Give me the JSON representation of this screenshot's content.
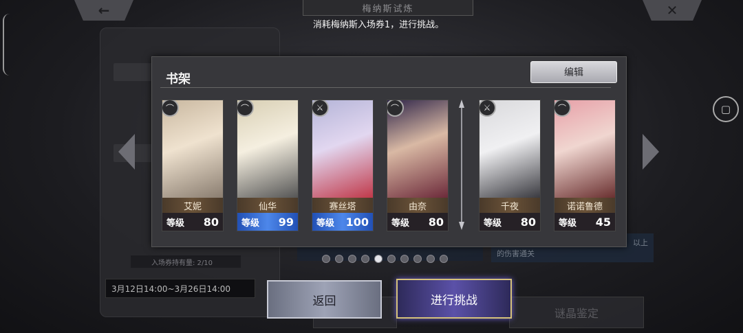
{
  "header": {
    "back_icon": "left-arrow-icon",
    "close_icon": "x-icon",
    "title": "梅纳斯试炼",
    "subtitle": "消耗梅纳斯入场券1，进行挑战。"
  },
  "background": {
    "date_range": "3月12日14:00~3月26日14:00",
    "ticket_count": "入场券持有量: 2/10",
    "right_hint": "的伤害通关",
    "right_hint_tail": "以上",
    "bottom_right_button": "谜晶鉴定"
  },
  "modal": {
    "title": "书架",
    "edit_label": "编辑",
    "level_label": "等级",
    "cards": [
      {
        "name": "艾妮",
        "level": "80",
        "class_icon": "bow-icon",
        "highlight": false,
        "colors": [
          "#c9b8a0",
          "#efe2cf",
          "#8a7d70"
        ]
      },
      {
        "name": "仙华",
        "level": "99",
        "class_icon": "bow-icon",
        "highlight": true,
        "colors": [
          "#d8cfb4",
          "#f5efe0",
          "#555"
        ]
      },
      {
        "name": "赛丝塔",
        "level": "100",
        "class_icon": "sword-icon",
        "highlight": true,
        "colors": [
          "#b5b5d8",
          "#e2d7f0",
          "#c0394a"
        ]
      },
      {
        "name": "由奈",
        "level": "80",
        "class_icon": "bow-icon",
        "highlight": false,
        "colors": [
          "#30264a",
          "#d9b9a4",
          "#6c2a3a"
        ]
      },
      {
        "name": "千夜",
        "level": "80",
        "class_icon": "sword-icon",
        "highlight": false,
        "colors": [
          "#d9d9dc",
          "#f0f0f2",
          "#3a3a40"
        ]
      },
      {
        "name": "诺诺鲁德",
        "level": "45",
        "class_icon": "bow-icon",
        "highlight": false,
        "colors": [
          "#e7a0a8",
          "#f0d6d0",
          "#6a3030"
        ]
      }
    ]
  },
  "pagination": {
    "total": 10,
    "active": 5
  },
  "actions": {
    "back_label": "返回",
    "challenge_label": "进行挑战"
  }
}
